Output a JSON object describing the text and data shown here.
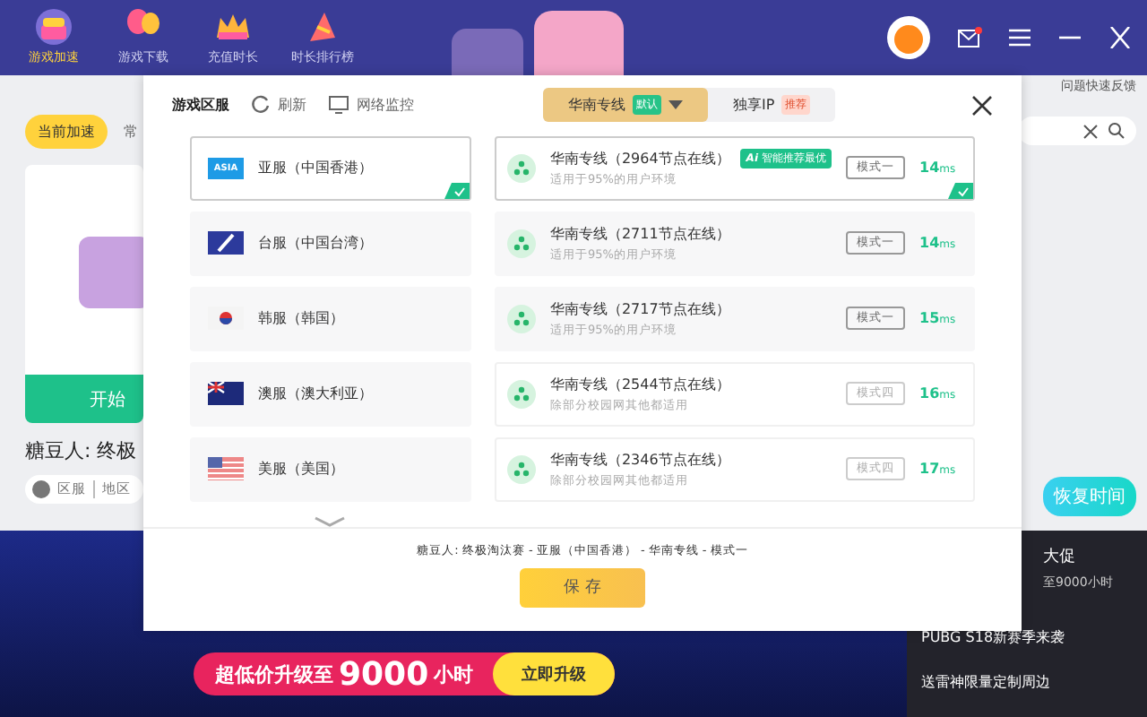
{
  "nav": [
    {
      "label": "游戏加速",
      "selected": true,
      "kind": "cake"
    },
    {
      "label": "游戏下载",
      "selected": false,
      "kind": "balloon"
    },
    {
      "label": "充值时长",
      "selected": false,
      "kind": "crown"
    },
    {
      "label": "时长排行榜",
      "selected": false,
      "kind": "hat"
    }
  ],
  "header_links": [
    "问题快速反馈"
  ],
  "side": {
    "tabs": [
      {
        "label": "当前加速",
        "selected": true
      },
      {
        "label": "常",
        "selected": false
      }
    ],
    "start_button": "开始",
    "game_title": "糖豆人: 终极",
    "region_chips": [
      "区服",
      "地区"
    ],
    "restore_button": "恢复时间"
  },
  "promo_side": [
    "大促",
    "至9000小时"
  ],
  "news": [
    "PUBG S18新赛季来袭",
    "送雷神限量定制周边"
  ],
  "banner": {
    "text": "超低价升级至",
    "number": "9000",
    "unit": "小时",
    "button": "立即升级"
  },
  "modal": {
    "title": "游戏区服",
    "refresh": "刷新",
    "monitor": "网络监控",
    "line_tabs": [
      {
        "label": "华南专线",
        "badge": "默认",
        "selected": true
      },
      {
        "label": "独享IP",
        "badge": "推荐",
        "selected": false
      }
    ],
    "servers": [
      {
        "name": "亚服（中国香港）",
        "kind": "asia",
        "flag_text": "ASIA",
        "selected": true
      },
      {
        "name": "台服（中国台湾）",
        "kind": "tw",
        "selected": false
      },
      {
        "name": "韩服（韩国）",
        "kind": "kr",
        "selected": false
      },
      {
        "name": "澳服（澳大利亚）",
        "kind": "au",
        "selected": false
      },
      {
        "name": "美服（美国）",
        "kind": "us",
        "selected": false
      }
    ],
    "lines": [
      {
        "name": "华南专线（2964节点在线）",
        "tag_ai": "Ai",
        "tag": "智能推荐最优",
        "desc": "适用于95%的用户环境",
        "mode": "模式一",
        "mode_active": true,
        "ms": "14",
        "unit": "ms",
        "selected": true
      },
      {
        "name": "华南专线（2711节点在线）",
        "desc": "适用于95%的用户环境",
        "mode": "模式一",
        "mode_active": true,
        "ms": "14",
        "unit": "ms",
        "selected": false
      },
      {
        "name": "华南专线（2717节点在线）",
        "desc": "适用于95%的用户环境",
        "mode": "模式一",
        "mode_active": true,
        "ms": "15",
        "unit": "ms",
        "selected": false
      },
      {
        "name": "华南专线（2544节点在线）",
        "desc": "除部分校园网其他都适用",
        "mode": "模式四",
        "mode_active": false,
        "ms": "16",
        "unit": "ms",
        "selected": false
      },
      {
        "name": "华南专线（2346节点在线）",
        "desc": "除部分校园网其他都适用",
        "mode": "模式四",
        "mode_active": false,
        "ms": "17",
        "unit": "ms",
        "selected": false
      }
    ],
    "summary": "糖豆人: 终极淘汰赛 - 亚服（中国香港） - 华南专线 - 模式一",
    "save": "保 存"
  }
}
